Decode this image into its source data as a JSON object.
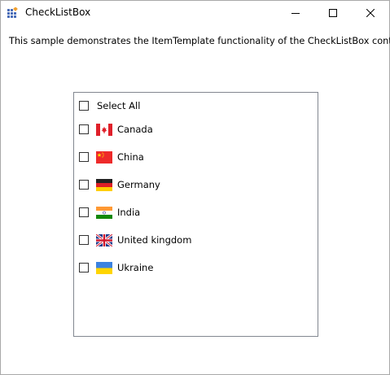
{
  "window": {
    "title": "CheckListBox",
    "app_icon": "app-grid-icon",
    "controls": {
      "minimize": "minimize-icon",
      "maximize": "maximize-icon",
      "close": "close-icon"
    }
  },
  "description": "This sample demonstrates the ItemTemplate functionality of the CheckListBox control.",
  "checklist": {
    "select_all_label": "Select All",
    "select_all_checked": false,
    "items": [
      {
        "label": "Canada",
        "flag": "canada-flag",
        "checked": false
      },
      {
        "label": "China",
        "flag": "china-flag",
        "checked": false
      },
      {
        "label": "Germany",
        "flag": "germany-flag",
        "checked": false
      },
      {
        "label": "India",
        "flag": "india-flag",
        "checked": false
      },
      {
        "label": "United kingdom",
        "flag": "uk-flag",
        "checked": false
      },
      {
        "label": "Ukraine",
        "flag": "ukraine-flag",
        "checked": false
      }
    ]
  }
}
